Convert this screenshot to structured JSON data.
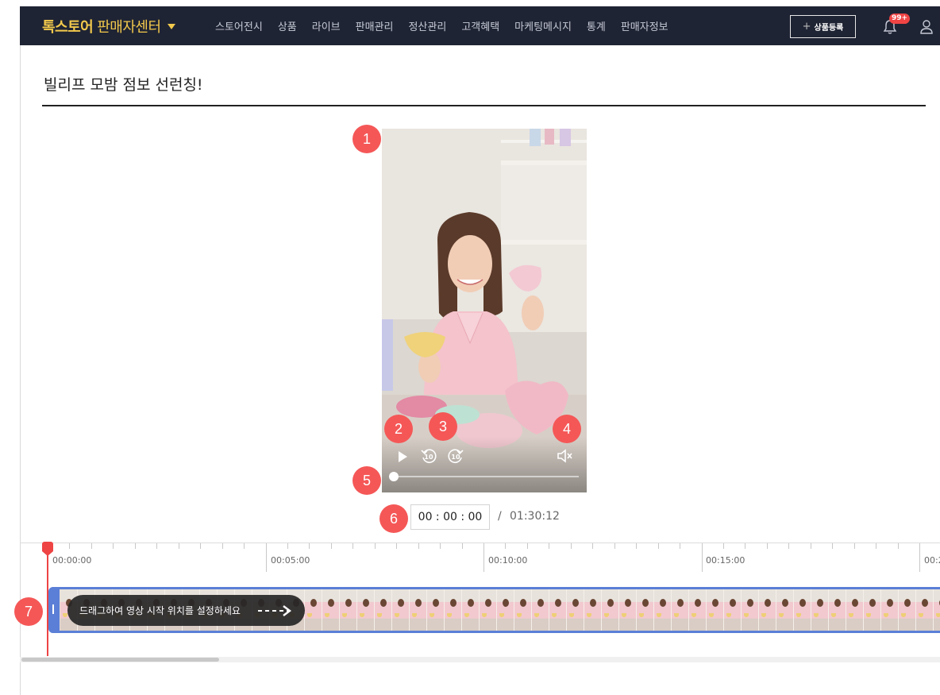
{
  "header": {
    "brand_primary": "톡스토어",
    "brand_secondary": "판매자센터",
    "nav": [
      "스토어전시",
      "상품",
      "라이브",
      "판매관리",
      "정산관리",
      "고객혜택",
      "마케팅메시지",
      "통계",
      "판매자정보"
    ],
    "register_label": "상품등록",
    "notification_badge": "99+"
  },
  "page": {
    "title": "빌리프 모밤 점보 선런칭!"
  },
  "player": {
    "current_time": "00 : 00 : 00",
    "separator": "/",
    "total_time": "01:30:12",
    "progress": 0,
    "muted": true
  },
  "timeline": {
    "ticks": [
      "00:00:00",
      "00:05:00",
      "00:10:00",
      "00:15:00",
      "00:2"
    ],
    "drag_hint": "드래그하여 영상 시작 위치를 설정하세요"
  },
  "markers": [
    "1",
    "2",
    "3",
    "4",
    "5",
    "6",
    "7"
  ],
  "colors": {
    "nav_bg": "#1f2434",
    "brand_yellow": "#f2c94c",
    "marker_red": "#f55757",
    "clip_blue": "#5b7fd6",
    "playhead_red": "#ee4444"
  }
}
